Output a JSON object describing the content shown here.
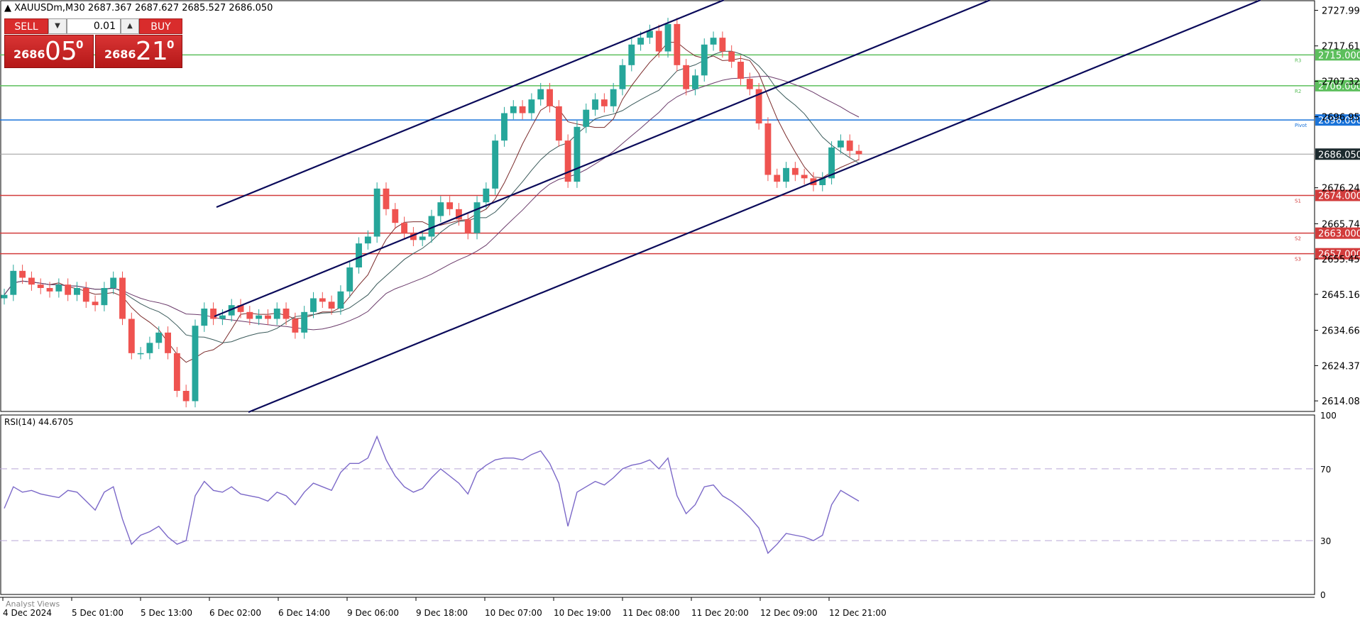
{
  "header": {
    "symbol_line": "▲ XAUUSDm,M30  2687.367 2687.627 2685.527 2686.050"
  },
  "ticket": {
    "sell_label": "SELL",
    "buy_label": "BUY",
    "lot": "0.01",
    "sell_price_small": "2686",
    "sell_price_big": "05",
    "sell_price_sup": "0",
    "buy_price_small": "2686",
    "buy_price_big": "21",
    "buy_price_sup": "0",
    "down_arrow": "▼",
    "up_arrow": "▲"
  },
  "price_axis": {
    "ticks": [
      {
        "label": "2727.990",
        "value": 2727.99
      },
      {
        "label": "2717.610",
        "value": 2717.61
      },
      {
        "label": "2707.320",
        "value": 2707.32
      },
      {
        "label": "2696.950",
        "value": 2696.95
      },
      {
        "label": "2676.240",
        "value": 2676.24
      },
      {
        "label": "2665.740",
        "value": 2665.74
      },
      {
        "label": "2655.450",
        "value": 2655.45
      },
      {
        "label": "2645.160",
        "value": 2645.16
      },
      {
        "label": "2634.660",
        "value": 2634.66
      },
      {
        "label": "2624.370",
        "value": 2624.37
      },
      {
        "label": "2614.080",
        "value": 2614.08
      }
    ]
  },
  "levels": [
    {
      "label": "2715.000",
      "value": 2715.0,
      "color": "#5cbf5c",
      "tag": "R3"
    },
    {
      "label": "2706.000",
      "value": 2706.0,
      "color": "#5cbf5c",
      "tag": "R2"
    },
    {
      "label": "2696.000",
      "value": 2696.0,
      "color": "#1a73d9",
      "tag": "Pivot"
    },
    {
      "label": "2674.000",
      "value": 2674.0,
      "color": "#d23c3c",
      "tag": "S1"
    },
    {
      "label": "2663.000",
      "value": 2663.0,
      "color": "#d23c3c",
      "tag": "S2"
    },
    {
      "label": "2657.000",
      "value": 2657.0,
      "color": "#d23c3c",
      "tag": "S3"
    }
  ],
  "current_price": {
    "label": "2686.050",
    "value": 2686.05
  },
  "rsi": {
    "title": "RSI(14) 44.6705",
    "ticks": [
      {
        "label": "100",
        "value": 100
      },
      {
        "label": "70",
        "value": 70
      },
      {
        "label": "30",
        "value": 30
      },
      {
        "label": "0",
        "value": 0
      }
    ]
  },
  "time_axis": [
    "4 Dec 2024",
    "5 Dec 01:00",
    "5 Dec 13:00",
    "6 Dec 02:00",
    "6 Dec 14:00",
    "9 Dec 06:00",
    "9 Dec 18:00",
    "10 Dec 07:00",
    "10 Dec 19:00",
    "11 Dec 08:00",
    "11 Dec 20:00",
    "12 Dec 09:00",
    "12 Dec 21:00"
  ],
  "bottom_label": "Analyst Views",
  "colors": {
    "bull": "#26a69a",
    "bear": "#ef5350",
    "channel": "#0a0a5a",
    "rsi_line": "#7b68c8",
    "ma": "#555555"
  },
  "chart_data": {
    "type": "candlestick",
    "close_series": [
      2645,
      2652,
      2650,
      2648,
      2647,
      2646,
      2648,
      2645,
      2647,
      2643,
      2642,
      2647,
      2650,
      2638,
      2628,
      2628,
      2631,
      2634,
      2628,
      2617,
      2614,
      2636,
      2641,
      2638,
      2639,
      2642,
      2640,
      2638,
      2639,
      2638,
      2641,
      2638,
      2634,
      2640,
      2644,
      2643,
      2641,
      2646,
      2653,
      2660,
      2662,
      2676,
      2670,
      2666,
      2663,
      2661,
      2662,
      2668,
      2672,
      2670,
      2667,
      2663,
      2672,
      2676,
      2690,
      2698,
      2700,
      2698,
      2702,
      2705,
      2700,
      2690,
      2678,
      2694,
      2699,
      2702,
      2700,
      2705,
      2712,
      2718,
      2720,
      2722,
      2716,
      2724,
      2712,
      2705,
      2709,
      2718,
      2720,
      2716,
      2713,
      2708,
      2705,
      2695,
      2680,
      2678,
      2682,
      2680,
      2679,
      2677,
      2679,
      2688,
      2690,
      2687,
      2686
    ],
    "rsi_series": [
      48,
      60,
      57,
      58,
      56,
      55,
      54,
      58,
      57,
      52,
      47,
      57,
      60,
      42,
      28,
      33,
      35,
      38,
      32,
      28,
      30,
      55,
      63,
      58,
      57,
      60,
      56,
      55,
      54,
      52,
      57,
      55,
      50,
      57,
      62,
      60,
      58,
      68,
      73,
      73,
      76,
      88,
      75,
      66,
      60,
      57,
      59,
      65,
      70,
      66,
      62,
      56,
      68,
      72,
      75,
      76,
      76,
      75,
      78,
      80,
      73,
      62,
      38,
      57,
      60,
      63,
      61,
      65,
      70,
      72,
      73,
      75,
      70,
      76,
      55,
      45,
      50,
      60,
      61,
      55,
      52,
      48,
      43,
      37,
      23,
      28,
      34,
      33,
      32,
      30,
      33,
      50,
      58,
      55,
      52
    ],
    "ylim": [
      2611,
      2731
    ]
  }
}
